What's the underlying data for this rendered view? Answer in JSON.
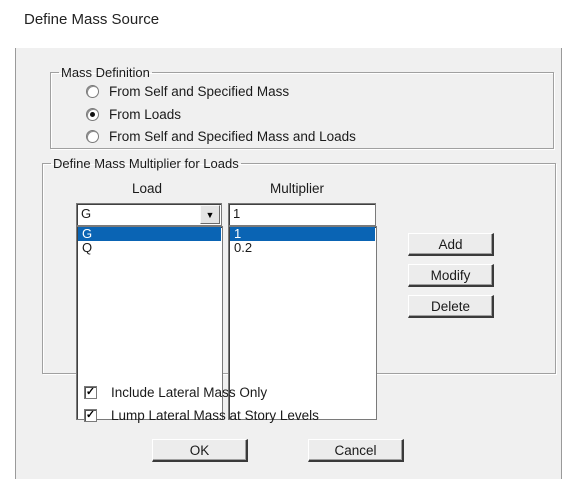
{
  "window": {
    "title": "Define Mass Source"
  },
  "mass_definition": {
    "legend": "Mass Definition",
    "options": [
      {
        "label": "From Self and Specified Mass",
        "checked": false
      },
      {
        "label": "From Loads",
        "checked": true
      },
      {
        "label": "From Self and Specified Mass and Loads",
        "checked": false
      }
    ]
  },
  "multiplier_group": {
    "legend": "Define Mass Multiplier for Loads",
    "load_header": "Load",
    "multiplier_header": "Multiplier",
    "load_select_value": "G",
    "multiplier_input_value": "1",
    "load_list": [
      "G",
      "Q"
    ],
    "multiplier_list": [
      "1",
      "0.2"
    ],
    "selected_index": 0,
    "buttons": {
      "add": "Add",
      "modify": "Modify",
      "delete": "Delete"
    }
  },
  "options": {
    "include_lateral": {
      "label": "Include Lateral Mass Only",
      "checked": true
    },
    "lump_lateral": {
      "label": "Lump Lateral Mass at Story Levels",
      "checked": true
    }
  },
  "footer": {
    "ok": "OK",
    "cancel": "Cancel"
  },
  "colors": {
    "selection": "#0a64b4",
    "dialog_bg": "#f0f0f0"
  },
  "icons": {
    "combo_arrow": "chevron-down-icon",
    "check": "check-icon"
  }
}
